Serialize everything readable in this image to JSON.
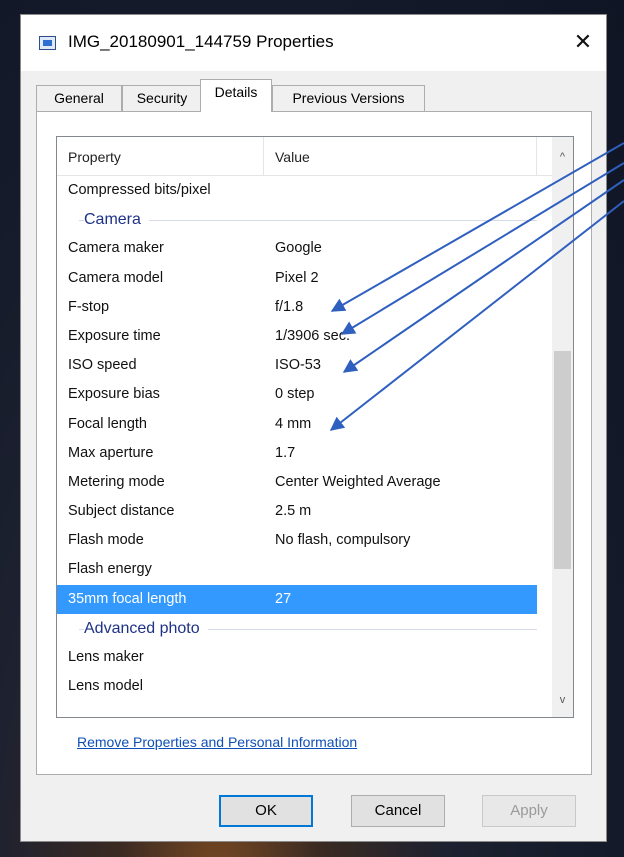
{
  "window": {
    "title": "IMG_20180901_144759 Properties",
    "icon": "image-file-icon",
    "close_glyph": "✕"
  },
  "tabs": [
    "General",
    "Security",
    "Details",
    "Previous Versions"
  ],
  "active_tab": "Details",
  "columns": {
    "property": "Property",
    "value": "Value"
  },
  "rows": [
    {
      "kind": "prop",
      "property": "Compressed bits/pixel",
      "value": ""
    },
    {
      "kind": "group",
      "label": "Camera"
    },
    {
      "kind": "prop",
      "property": "Camera maker",
      "value": "Google"
    },
    {
      "kind": "prop",
      "property": "Camera model",
      "value": "Pixel 2"
    },
    {
      "kind": "prop",
      "property": "F-stop",
      "value": "f/1.8"
    },
    {
      "kind": "prop",
      "property": "Exposure time",
      "value": "1/3906 sec."
    },
    {
      "kind": "prop",
      "property": "ISO speed",
      "value": "ISO-53"
    },
    {
      "kind": "prop",
      "property": "Exposure bias",
      "value": "0 step"
    },
    {
      "kind": "prop",
      "property": "Focal length",
      "value": "4 mm"
    },
    {
      "kind": "prop",
      "property": "Max aperture",
      "value": "1.7"
    },
    {
      "kind": "prop",
      "property": "Metering mode",
      "value": "Center Weighted Average"
    },
    {
      "kind": "prop",
      "property": "Subject distance",
      "value": "2.5 m"
    },
    {
      "kind": "prop",
      "property": "Flash mode",
      "value": "No flash, compulsory"
    },
    {
      "kind": "prop",
      "property": "Flash energy",
      "value": ""
    },
    {
      "kind": "prop",
      "property": "35mm focal length",
      "value": "27",
      "selected": true
    },
    {
      "kind": "group",
      "label": "Advanced photo"
    },
    {
      "kind": "prop",
      "property": "Lens maker",
      "value": ""
    },
    {
      "kind": "prop",
      "property": "Lens model",
      "value": ""
    }
  ],
  "scrollbar": {
    "up_glyph": "^",
    "down_glyph": "v"
  },
  "link": "Remove Properties and Personal Information",
  "buttons": {
    "ok": "OK",
    "cancel": "Cancel",
    "apply": "Apply"
  },
  "colors": {
    "selection": "#3399ff",
    "group_text": "#1e3287",
    "link": "#0f4fb8",
    "annotation_arrow": "#2f5fbf"
  }
}
